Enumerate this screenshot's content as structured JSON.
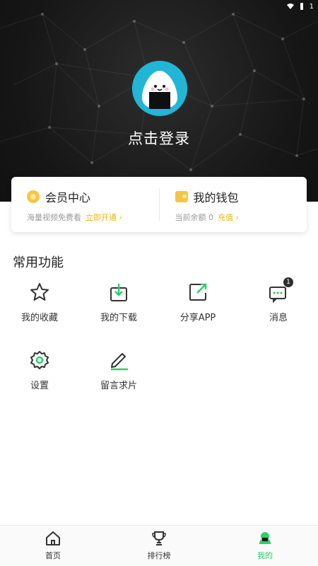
{
  "status": {
    "battery": "1"
  },
  "header": {
    "login_text": "点击登录"
  },
  "card": {
    "vip": {
      "title": "会员中心",
      "subtitle": "海量视频免费看",
      "action": "立即开通 ›"
    },
    "wallet": {
      "title": "我的钱包",
      "subtitle": "当前余额 0",
      "action": "充值 ›"
    }
  },
  "section": {
    "title": "常用功能"
  },
  "functions": [
    {
      "label": "我的收藏",
      "icon": "star-icon"
    },
    {
      "label": "我的下载",
      "icon": "download-icon"
    },
    {
      "label": "分享APP",
      "icon": "share-icon"
    },
    {
      "label": "消息",
      "icon": "message-icon",
      "badge": "1"
    },
    {
      "label": "设置",
      "icon": "gear-icon"
    },
    {
      "label": "留言求片",
      "icon": "edit-icon"
    }
  ],
  "nav": [
    {
      "label": "首页",
      "icon": "home-icon"
    },
    {
      "label": "排行榜",
      "icon": "trophy-icon"
    },
    {
      "label": "我的",
      "icon": "profile-icon",
      "active": true
    }
  ],
  "colors": {
    "accent": "#2ccf6d",
    "gold": "#f6c543",
    "header_bg": "#1a1a1a"
  }
}
